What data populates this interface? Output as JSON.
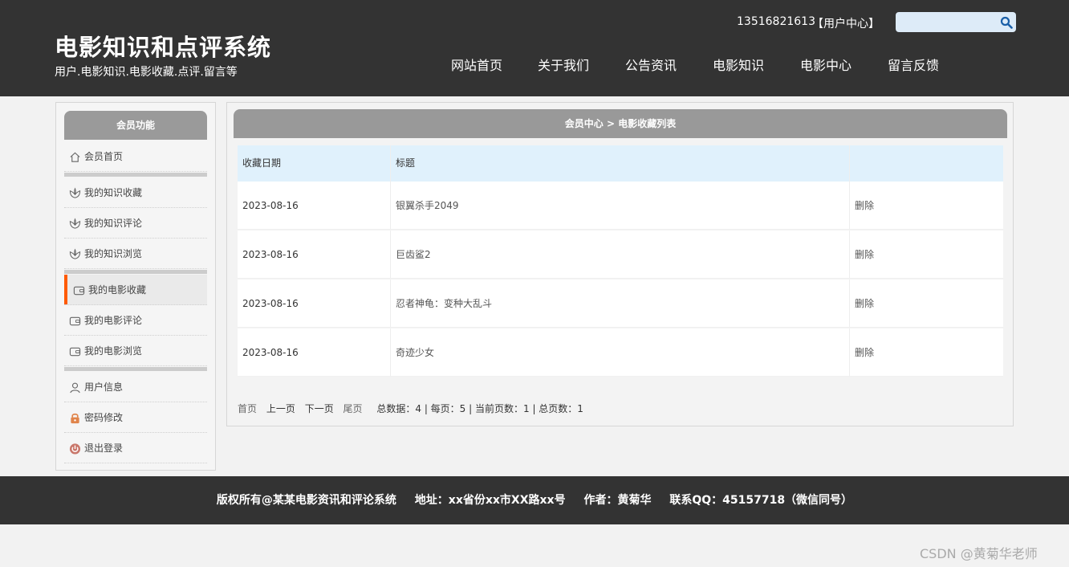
{
  "header": {
    "title": "电影知识和点评系统",
    "subtitle": "用户.电影知识.电影收藏.点评.留言等",
    "phone": "13516821613",
    "user_center": "【用户中心】",
    "search_placeholder": "",
    "nav": [
      "网站首页",
      "关于我们",
      "公告资讯",
      "电影知识",
      "电影中心",
      "留言反馈"
    ]
  },
  "sidebar": {
    "title": "会员功能",
    "items": [
      {
        "label": "会员首页",
        "icon": "home-icon"
      },
      {
        "label": "我的知识收藏",
        "icon": "lotus-icon"
      },
      {
        "label": "我的知识评论",
        "icon": "lotus-icon"
      },
      {
        "label": "我的知识浏览",
        "icon": "lotus-icon"
      },
      {
        "label": "我的电影收藏",
        "icon": "wallet-icon",
        "active": true
      },
      {
        "label": "我的电影评论",
        "icon": "wallet-icon"
      },
      {
        "label": "我的电影浏览",
        "icon": "wallet-icon"
      },
      {
        "label": "用户信息",
        "icon": "user-icon"
      },
      {
        "label": "密码修改",
        "icon": "lock-icon"
      },
      {
        "label": "退出登录",
        "icon": "power-icon"
      }
    ]
  },
  "main": {
    "breadcrumb": "会员中心 > 电影收藏列表",
    "columns": [
      "收藏日期",
      "标题",
      ""
    ],
    "rows": [
      {
        "date": "2023-08-16",
        "title": "银翼杀手2049",
        "action": "删除"
      },
      {
        "date": "2023-08-16",
        "title": "巨齿鲨2",
        "action": "删除"
      },
      {
        "date": "2023-08-16",
        "title": "忍者神龟：变种大乱斗",
        "action": "删除"
      },
      {
        "date": "2023-08-16",
        "title": "奇迹少女",
        "action": "删除"
      }
    ],
    "pager": {
      "first": "首页",
      "prev": "上一页",
      "next": "下一页",
      "last": "尾页",
      "summary": "总数据：4 | 每页：5 | 当前页数：1 | 总页数：1"
    }
  },
  "footer": {
    "copyright": "版权所有@某某电影资讯和评论系统",
    "address": "地址：xx省份xx市XX路xx号",
    "author": "作者：黄菊华",
    "contact": "联系QQ：45157718（微信同号）"
  },
  "watermark": "CSDN @黄菊华老师",
  "colors": {
    "header_bg": "#333333",
    "accent": "#ff5a00",
    "table_head_bg": "#e0f1fc",
    "panel_header_bg": "#999999"
  }
}
